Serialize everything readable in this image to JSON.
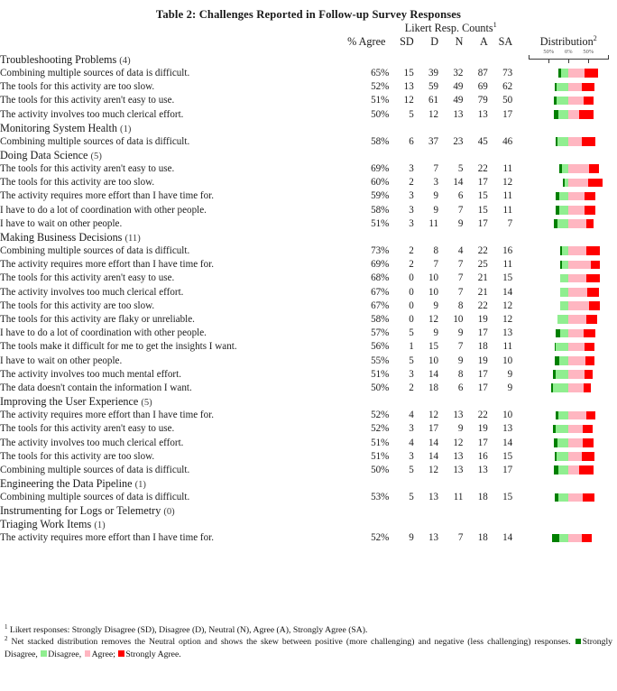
{
  "title": "Table 2: Challenges Reported in Follow-up Survey Responses",
  "header": {
    "group_label": "Likert Resp. Counts",
    "group_sup": "1",
    "agree": "% Agree",
    "sd": "SD",
    "d": "D",
    "n": "N",
    "a": "A",
    "sa": "SA",
    "distribution": "Distribution",
    "distribution_sup": "2"
  },
  "axis": {
    "labels": [
      "50%",
      "0%",
      "50%"
    ],
    "label_positions_pct": [
      25,
      50,
      75
    ]
  },
  "colors": {
    "strongly_disagree": "#008000",
    "disagree": "#90ee90",
    "agree": "#ffb6c1",
    "strongly_agree": "#ff0000",
    "rule": "#3a3a3a",
    "text": "#1a1a1a"
  },
  "sections": [
    {
      "name": "Troubleshooting Problems",
      "count": "(4)",
      "rows": [
        {
          "label": "Combining multiple sources of data is difficult.",
          "agree": "65%",
          "sd": "15",
          "d": "39",
          "n": "32",
          "a": "87",
          "sa": "73"
        },
        {
          "label": "The tools for this activity are too slow.",
          "agree": "52%",
          "sd": "13",
          "d": "59",
          "n": "49",
          "a": "69",
          "sa": "62"
        },
        {
          "label": "The tools for this activity aren't easy to use.",
          "agree": "51%",
          "sd": "12",
          "d": "61",
          "n": "49",
          "a": "79",
          "sa": "50"
        },
        {
          "label": "The activity involves too much clerical effort.",
          "agree": "50%",
          "sd": "5",
          "d": "12",
          "n": "13",
          "a": "13",
          "sa": "17"
        }
      ]
    },
    {
      "name": "Monitoring System Health",
      "count": "(1)",
      "rows": [
        {
          "label": "Combining multiple sources of data is difficult.",
          "agree": "58%",
          "sd": "6",
          "d": "37",
          "n": "23",
          "a": "45",
          "sa": "46"
        }
      ]
    },
    {
      "name": "Doing Data Science",
      "count": "(5)",
      "rows": [
        {
          "label": "The tools for this activity aren't easy to use.",
          "agree": "69%",
          "sd": "3",
          "d": "7",
          "n": "5",
          "a": "22",
          "sa": "11"
        },
        {
          "label": "The tools for this activity are too slow.",
          "agree": "60%",
          "sd": "2",
          "d": "3",
          "n": "14",
          "a": "17",
          "sa": "12"
        },
        {
          "label": "The activity requires more effort than I have time for.",
          "agree": "59%",
          "sd": "3",
          "d": "9",
          "n": "6",
          "a": "15",
          "sa": "11"
        },
        {
          "label": "I have to do a lot of coordination with other people.",
          "agree": "58%",
          "sd": "3",
          "d": "9",
          "n": "7",
          "a": "15",
          "sa": "11"
        },
        {
          "label": "I have to wait on other people.",
          "agree": "51%",
          "sd": "3",
          "d": "11",
          "n": "9",
          "a": "17",
          "sa": "7"
        }
      ]
    },
    {
      "name": "Making Business Decisions",
      "count": "(11)",
      "rows": [
        {
          "label": "Combining multiple sources of data is difficult.",
          "agree": "73%",
          "sd": "2",
          "d": "8",
          "n": "4",
          "a": "22",
          "sa": "16"
        },
        {
          "label": "The activity requires more effort than I have time for.",
          "agree": "69%",
          "sd": "2",
          "d": "7",
          "n": "7",
          "a": "25",
          "sa": "11"
        },
        {
          "label": "The tools for this activity aren't easy to use.",
          "agree": "68%",
          "sd": "0",
          "d": "10",
          "n": "7",
          "a": "21",
          "sa": "15"
        },
        {
          "label": "The activity involves too much clerical effort.",
          "agree": "67%",
          "sd": "0",
          "d": "10",
          "n": "7",
          "a": "21",
          "sa": "14"
        },
        {
          "label": "The tools for this activity are too slow.",
          "agree": "67%",
          "sd": "0",
          "d": "9",
          "n": "8",
          "a": "22",
          "sa": "12"
        },
        {
          "label": "The tools for this activity are flaky or unreliable.",
          "agree": "58%",
          "sd": "0",
          "d": "12",
          "n": "10",
          "a": "19",
          "sa": "12"
        },
        {
          "label": "I have to do a lot of coordination with other people.",
          "agree": "57%",
          "sd": "5",
          "d": "9",
          "n": "9",
          "a": "17",
          "sa": "13"
        },
        {
          "label": "The tools make it difficult for me to get the insights I want.",
          "agree": "56%",
          "sd": "1",
          "d": "15",
          "n": "7",
          "a": "18",
          "sa": "11"
        },
        {
          "label": "I have to wait on other people.",
          "agree": "55%",
          "sd": "5",
          "d": "10",
          "n": "9",
          "a": "19",
          "sa": "10"
        },
        {
          "label": "The activity involves too much mental effort.",
          "agree": "51%",
          "sd": "3",
          "d": "14",
          "n": "8",
          "a": "17",
          "sa": "9"
        },
        {
          "label": "The data doesn't contain the information I want.",
          "agree": "50%",
          "sd": "2",
          "d": "18",
          "n": "6",
          "a": "17",
          "sa": "9"
        }
      ]
    },
    {
      "name": "Improving the User Experience",
      "count": "(5)",
      "rows": [
        {
          "label": "The activity requires more effort than I have time for.",
          "agree": "52%",
          "sd": "4",
          "d": "12",
          "n": "13",
          "a": "22",
          "sa": "10"
        },
        {
          "label": "The tools for this activity aren't easy to use.",
          "agree": "52%",
          "sd": "3",
          "d": "17",
          "n": "9",
          "a": "19",
          "sa": "13"
        },
        {
          "label": "The activity involves too much clerical effort.",
          "agree": "51%",
          "sd": "4",
          "d": "14",
          "n": "12",
          "a": "17",
          "sa": "14"
        },
        {
          "label": "The tools for this activity are too slow.",
          "agree": "51%",
          "sd": "3",
          "d": "14",
          "n": "13",
          "a": "16",
          "sa": "15"
        },
        {
          "label": "Combining multiple sources of data is difficult.",
          "agree": "50%",
          "sd": "5",
          "d": "12",
          "n": "13",
          "a": "13",
          "sa": "17"
        }
      ]
    },
    {
      "name": "Engineering the Data Pipeline",
      "count": "(1)",
      "rows": [
        {
          "label": "Combining multiple sources of data is difficult.",
          "agree": "53%",
          "sd": "5",
          "d": "13",
          "n": "11",
          "a": "18",
          "sa": "15"
        }
      ]
    },
    {
      "name": "Instrumenting for Logs or Telemetry",
      "count": "(0)",
      "rows": []
    },
    {
      "name": "Triaging Work Items",
      "count": "(1)",
      "rows": [
        {
          "label": "The activity requires more effort than I have time for.",
          "agree": "52%",
          "sd": "9",
          "d": "13",
          "n": "7",
          "a": "18",
          "sa": "14"
        }
      ]
    }
  ],
  "footnotes": {
    "one_sup": "1",
    "one_text": "Likert responses: Strongly Disagree (SD), Disagree (D), Neutral (N), Agree (A), Strongly Agree (SA).",
    "two_sup": "2",
    "two_text_a": "Net stacked distribution removes the Neutral option and shows the skew between positive (more challenging) and negative (less challenging) responses.",
    "legend": [
      {
        "label": "Strongly Disagree,",
        "color": "#008000",
        "key": "sd"
      },
      {
        "label": "Disagree,",
        "color": "#90ee90",
        "key": "d"
      },
      {
        "label": "Agree;",
        "color": "#ffb6c1",
        "key": "a"
      },
      {
        "label": "Strongly Agree.",
        "color": "#ff0000",
        "key": "sa"
      }
    ]
  },
  "chart_data": {
    "type": "bar",
    "subtype": "diverging-stacked-likert",
    "title": "Net stacked distribution of Likert responses",
    "xlabel": "",
    "ylabel": "",
    "xlim": [
      -100,
      100
    ],
    "tick_labels": [
      "50%",
      "0%",
      "50%"
    ],
    "tick_values": [
      -50,
      0,
      50
    ],
    "grid": false,
    "legend_position": "footnote",
    "series": [
      {
        "name": "Strongly Disagree",
        "color": "#008000"
      },
      {
        "name": "Disagree",
        "color": "#90ee90"
      },
      {
        "name": "Agree",
        "color": "#ffb6c1"
      },
      {
        "name": "Strongly Agree",
        "color": "#ff0000"
      }
    ],
    "note": "Neutral (N) excluded from bars; percentages computed over SD+D+A+SA."
  }
}
